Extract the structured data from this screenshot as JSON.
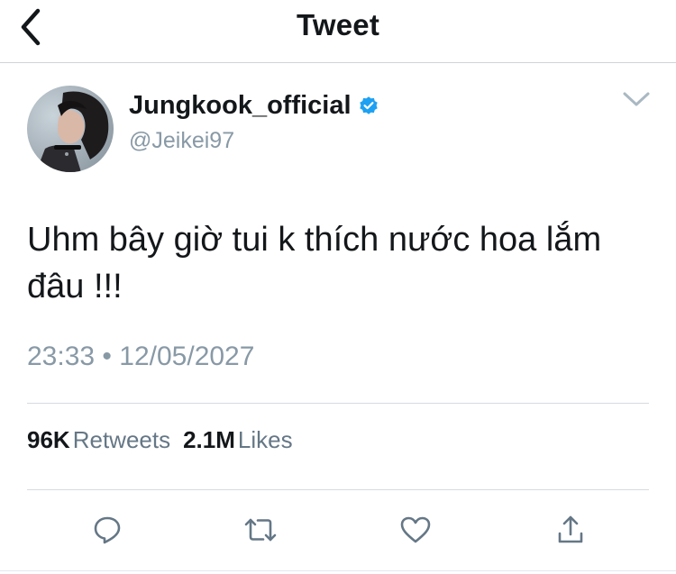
{
  "header": {
    "title": "Tweet",
    "back_icon": "chevron-left-icon"
  },
  "tweet": {
    "author": {
      "display_name": "Jungkook_official",
      "handle": "@Jeikei97",
      "verified": true
    },
    "text_lines": [
      "Uhm bây giờ tui k thích nước hoa lắm",
      "đâu !!!"
    ],
    "time": "23:33",
    "separator": "•",
    "date": "12/05/2027",
    "stats": {
      "retweets_count": "96K",
      "retweets_label": "Retweets",
      "likes_count": "2.1M",
      "likes_label": "Likes"
    }
  },
  "actions": [
    {
      "name": "reply",
      "icon": "reply-icon"
    },
    {
      "name": "retweet",
      "icon": "retweet-icon"
    },
    {
      "name": "like",
      "icon": "heart-icon"
    },
    {
      "name": "share",
      "icon": "share-icon"
    }
  ],
  "colors": {
    "text": "#14171a",
    "secondary": "#8899a6",
    "verified_blue": "#1da1f2",
    "icon_gray": "#657786",
    "divider": "#d6dbdf"
  }
}
